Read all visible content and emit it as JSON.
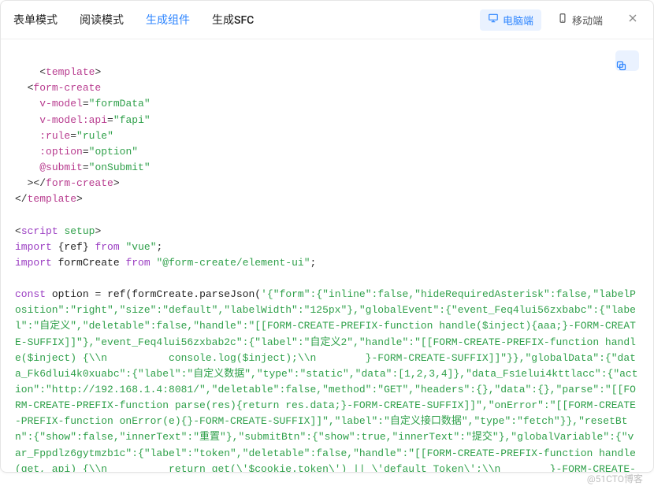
{
  "header": {
    "tabs": [
      {
        "id": "form-mode",
        "label": "表单模式",
        "active": false
      },
      {
        "id": "read-mode",
        "label": "阅读模式",
        "active": false
      },
      {
        "id": "gen-component",
        "label": "生成组件",
        "active": true
      },
      {
        "id": "gen-sfc",
        "label": "生成SFC",
        "active": false
      }
    ],
    "devices": {
      "desktop": "电脑端",
      "mobile": "移动端"
    }
  },
  "code": {
    "template_open": "template",
    "form_create_tag": "form-create",
    "attrs": {
      "vmodel": "v-model",
      "vmodel_val": "formData",
      "vmodel_api": "v-model:api",
      "vmodel_api_val": "fapi",
      "rule": ":rule",
      "rule_val": "rule",
      "option": ":option",
      "option_val": "option",
      "submit": "@submit",
      "submit_val": "onSubmit"
    },
    "script_tag": "script",
    "setup_attr": "setup",
    "import1_kw": "import",
    "import1_items": "{ref}",
    "from_kw": "from",
    "import1_pkg": "\"vue\"",
    "import2_name": "formCreate",
    "import2_pkg": "\"@form-create/element-ui\"",
    "const_kw": "const",
    "option_var": "option",
    "ref_call": "ref(formCreate.parseJson(",
    "json_body": "'{\"form\":{\"inline\":false,\"hideRequiredAsterisk\":false,\"labelPosition\":\"right\",\"size\":\"default\",\"labelWidth\":\"125px\"},\"globalEvent\":{\"event_Feq4lui56zxbabc\":{\"label\":\"自定义\",\"deletable\":false,\"handle\":\"[[FORM-CREATE-PREFIX-function handle($inject){aaa;}-FORM-CREATE-SUFFIX]]\"},\"event_Feq4lui56zxbab2c\":{\"label\":\"自定义2\",\"handle\":\"[[FORM-CREATE-PREFIX-function handle($inject) {\\\\n          console.log($inject);\\\\n        }-FORM-CREATE-SUFFIX]]\"}},\"globalData\":{\"data_Fk6dlui4k0xuabc\":{\"label\":\"自定义数据\",\"type\":\"static\",\"data\":[1,2,3,4]},\"data_Fs1elui4kttlacc\":{\"action\":\"http://192.168.1.4:8081/\",\"deletable\":false,\"method\":\"GET\",\"headers\":{},\"data\":{},\"parse\":\"[[FORM-CREATE-PREFIX-function parse(res){return res.data;}-FORM-CREATE-SUFFIX]]\",\"onError\":\"[[FORM-CREATE-PREFIX-function onError(e){}-FORM-CREATE-SUFFIX]]\",\"label\":\"自定义接口数据\",\"type\":\"fetch\"}},\"resetBtn\":{\"show\":false,\"innerText\":\"重置\"},\"submitBtn\":{\"show\":true,\"innerText\":\"提交\"},\"globalVariable\":{\"var_Fppdlz6gytmzb1c\":{\"label\":\"token\",\"deletable\":false,\"handle\":\"[[FORM-CREATE-PREFIX-function handle(get, api) {\\\\n          return get(\\'$cookie.token\\') || \\'default Token\\';\\\\n        }-FORM-CREATE-"
  },
  "watermark": "@51CTO博客"
}
